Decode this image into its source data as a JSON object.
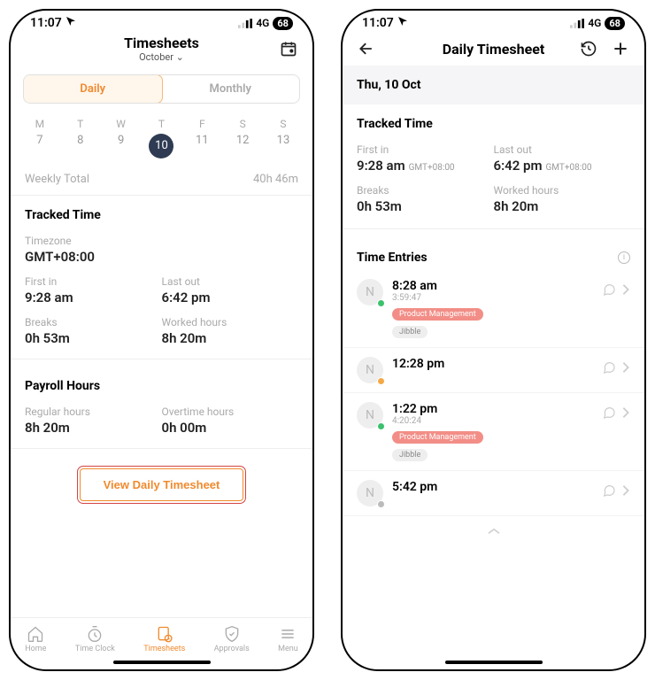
{
  "status": {
    "time": "11:07",
    "network": "4G",
    "battery": "68"
  },
  "left": {
    "title": "Timesheets",
    "month": "October",
    "tabs": {
      "daily": "Daily",
      "monthly": "Monthly"
    },
    "days": [
      "M",
      "T",
      "W",
      "T",
      "F",
      "S",
      "S"
    ],
    "nums": [
      "7",
      "8",
      "9",
      "10",
      "11",
      "12",
      "13"
    ],
    "selected_index": 3,
    "weekly_label": "Weekly Total",
    "weekly_value": "40h 46m",
    "tracked_title": "Tracked Time",
    "timezone_label": "Timezone",
    "timezone_value": "GMT+08:00",
    "first_in_label": "First in",
    "first_in_value": "9:28 am",
    "last_out_label": "Last out",
    "last_out_value": "6:42 pm",
    "breaks_label": "Breaks",
    "breaks_value": "0h 53m",
    "worked_label": "Worked hours",
    "worked_value": "8h 20m",
    "payroll_title": "Payroll Hours",
    "regular_label": "Regular hours",
    "regular_value": "8h 20m",
    "overtime_label": "Overtime hours",
    "overtime_value": "0h 00m",
    "cta": "View Daily Timesheet",
    "nav": {
      "home": "Home",
      "clock": "Time Clock",
      "sheets": "Timesheets",
      "approvals": "Approvals",
      "menu": "Menu"
    }
  },
  "right": {
    "title": "Daily Timesheet",
    "date": "Thu, 10 Oct",
    "tracked_title": "Tracked Time",
    "first_in_label": "First in",
    "first_in_value": "9:28 am",
    "last_out_label": "Last out",
    "last_out_value": "6:42 pm",
    "tz": "GMT+08:00",
    "breaks_label": "Breaks",
    "breaks_value": "0h 53m",
    "worked_label": "Worked hours",
    "worked_value": "8h 20m",
    "entries_title": "Time Entries",
    "entries": [
      {
        "initial": "N",
        "dot": "green",
        "time": "8:28 am",
        "dur": "3:59:47",
        "tag1": "Product Management",
        "tag2": "Jibble"
      },
      {
        "initial": "N",
        "dot": "orange",
        "time": "12:28 pm"
      },
      {
        "initial": "N",
        "dot": "green",
        "time": "1:22 pm",
        "dur": "4:20:24",
        "tag1": "Product Management",
        "tag2": "Jibble"
      },
      {
        "initial": "N",
        "dot": "gray",
        "time": "5:42 pm"
      }
    ]
  }
}
